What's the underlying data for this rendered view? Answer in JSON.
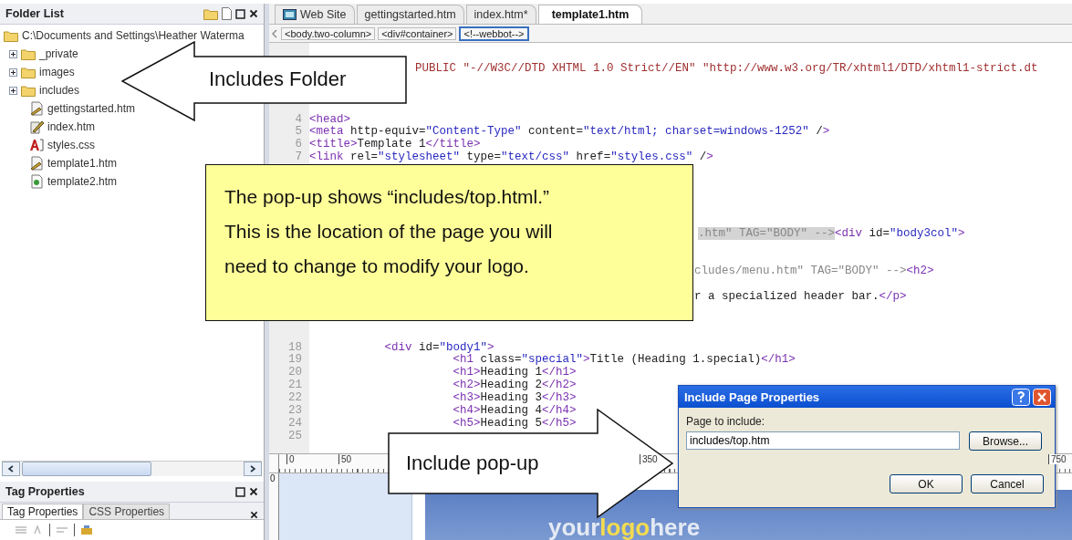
{
  "folder_list": {
    "title": "Folder List",
    "root": "C:\\Documents and Settings\\Heather Waterma",
    "items": [
      {
        "name": "_private",
        "kind": "folder",
        "expanded": false
      },
      {
        "name": "images",
        "kind": "folder",
        "expanded": false
      },
      {
        "name": "includes",
        "kind": "folder",
        "expanded": false
      },
      {
        "name": "gettingstarted.htm",
        "kind": "edited-page"
      },
      {
        "name": "index.htm",
        "kind": "home-page"
      },
      {
        "name": "styles.css",
        "kind": "stylesheet"
      },
      {
        "name": "template1.htm",
        "kind": "edited-page"
      },
      {
        "name": "template2.htm",
        "kind": "page"
      }
    ]
  },
  "tag_properties": {
    "title": "Tag Properties",
    "tabs": [
      {
        "label": "Tag Properties",
        "selected": true
      },
      {
        "label": "CSS Properties",
        "selected": false
      }
    ]
  },
  "editor": {
    "tabs": [
      {
        "label": "Web Site",
        "kind": "site",
        "selected": false
      },
      {
        "label": "gettingstarted.htm",
        "kind": "file",
        "selected": false
      },
      {
        "label": "index.htm*",
        "kind": "file",
        "selected": false
      },
      {
        "label": "template1.htm",
        "kind": "file",
        "selected": true
      }
    ],
    "breadcrumb": [
      {
        "label": "<body.two-column>",
        "selected": false
      },
      {
        "label": "<div#container>",
        "selected": false
      },
      {
        "label": "<!--webbot-->",
        "selected": true
      }
    ],
    "code_lines": [
      {
        "kind": "doctype",
        "code": "PUBLIC \"-//W3C//DTD XHTML 1.0 Strict//EN\" \"http://www.w3.org/TR/xhtml1/DTD/xhtml1-strict.dt"
      },
      {
        "kind": "hidden"
      },
      {
        "kind": "hidden"
      },
      {
        "kind": "hidden"
      },
      {
        "kind": "code",
        "number": "4",
        "code": "<head>"
      },
      {
        "kind": "code",
        "number": "5",
        "code": "<meta http-equiv=\"Content-Type\" content=\"text/html; charset=windows-1252\" />"
      },
      {
        "kind": "code",
        "number": "6",
        "code": "<title>Template 1</title>"
      },
      {
        "kind": "code",
        "number": "7",
        "code": "<link rel=\"stylesheet\" type=\"text/css\" href=\"styles.css\" />"
      },
      {
        "kind": "hidden"
      },
      {
        "kind": "hidden"
      },
      {
        "kind": "hidden"
      },
      {
        "kind": "hidden"
      },
      {
        "kind": "hidden"
      },
      {
        "kind": "comment-tail",
        "selected": true,
        "code": ".htm\" TAG=\"BODY\" --><div id=\"body3col\">"
      },
      {
        "kind": "hidden"
      },
      {
        "kind": "hidden"
      },
      {
        "kind": "comment-tail",
        "selected": false,
        "code": "cludes/menu.htm\" TAG=\"BODY\" --><h2>"
      },
      {
        "kind": "hidden"
      },
      {
        "kind": "text-tail",
        "code": "r a specialized header bar.</p>"
      },
      {
        "kind": "hidden"
      },
      {
        "kind": "hidden"
      },
      {
        "kind": "hidden"
      },
      {
        "kind": "code",
        "number": "18",
        "code": "           <div id=\"body1\">"
      },
      {
        "kind": "code",
        "number": "19",
        "code": "                     <h1 class=\"special\">Title (Heading 1.special)</h1>"
      },
      {
        "kind": "code",
        "number": "20",
        "code": "                     <h1>Heading 1</h1>"
      },
      {
        "kind": "code",
        "number": "21",
        "code": "                     <h2>Heading 2</h2>"
      },
      {
        "kind": "code",
        "number": "22",
        "code": "                     <h3>Heading 3</h3>"
      },
      {
        "kind": "code",
        "number": "23",
        "code": "                     <h4>Heading 4</h4>"
      },
      {
        "kind": "code",
        "number": "24",
        "code": "                     <h5>Heading 5</h5>"
      },
      {
        "kind": "code",
        "number": "25"
      }
    ],
    "ruler_labels": [
      "0",
      "50",
      "350",
      "750"
    ],
    "vertical_ruler_label": "0",
    "logo_parts": [
      {
        "text": "your",
        "color": "#e4eaf4"
      },
      {
        "text": "logo",
        "color": "#f4dc50"
      },
      {
        "text": "here",
        "color": "#e4eaf4"
      }
    ]
  },
  "dialog": {
    "title": "Include Page Properties",
    "field_label": "Page to include:",
    "value": "includes/top.htm",
    "browse_button": "Browse...",
    "buttons": [
      "OK",
      "Cancel"
    ]
  },
  "callouts": [
    {
      "kind": "left-arrow",
      "text": "Includes Folder"
    },
    {
      "kind": "note",
      "text": "The pop-up shows “includes/top.html.”\nThis is the location of the page you will\nneed to change to modify your logo."
    },
    {
      "kind": "right-arrow",
      "text": "Include pop-up"
    }
  ]
}
